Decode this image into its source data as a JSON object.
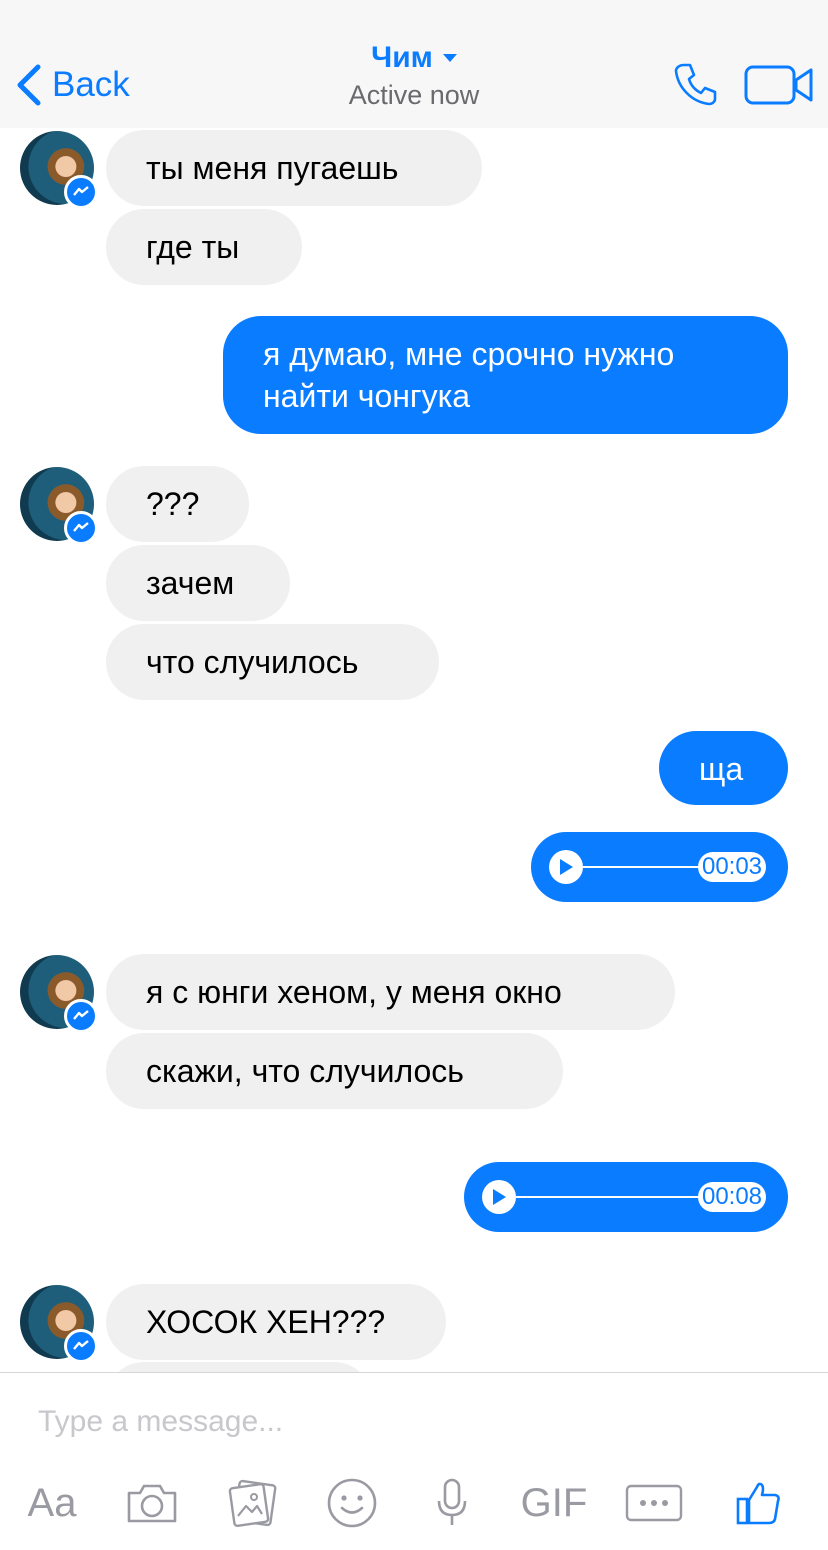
{
  "header": {
    "back_label": "Back",
    "contact_name": "Чим",
    "status": "Active now"
  },
  "messages": {
    "m1": "ты меня пугаешь",
    "m2": "где ты",
    "m3_line1": "я думаю, мне срочно нужно",
    "m3_line2": "найти чонгука",
    "m4": "???",
    "m5": "зачем",
    "m6": "что случилось",
    "m7": "ща",
    "voice1_time": "00:03",
    "m8": "я с юнги хеном, у меня окно",
    "m9": "скажи, что случилось",
    "voice2_time": "00:08",
    "m10": "ХОСОК ХЕН???"
  },
  "composer": {
    "placeholder": "Type a message...",
    "text_tool": "Aa",
    "gif_tool": "GIF"
  },
  "colors": {
    "accent": "#0a7cff",
    "incoming_bubble": "#f1f0f0",
    "header_bg": "#f7f7f8",
    "icon_gray": "#9a9aa2"
  }
}
